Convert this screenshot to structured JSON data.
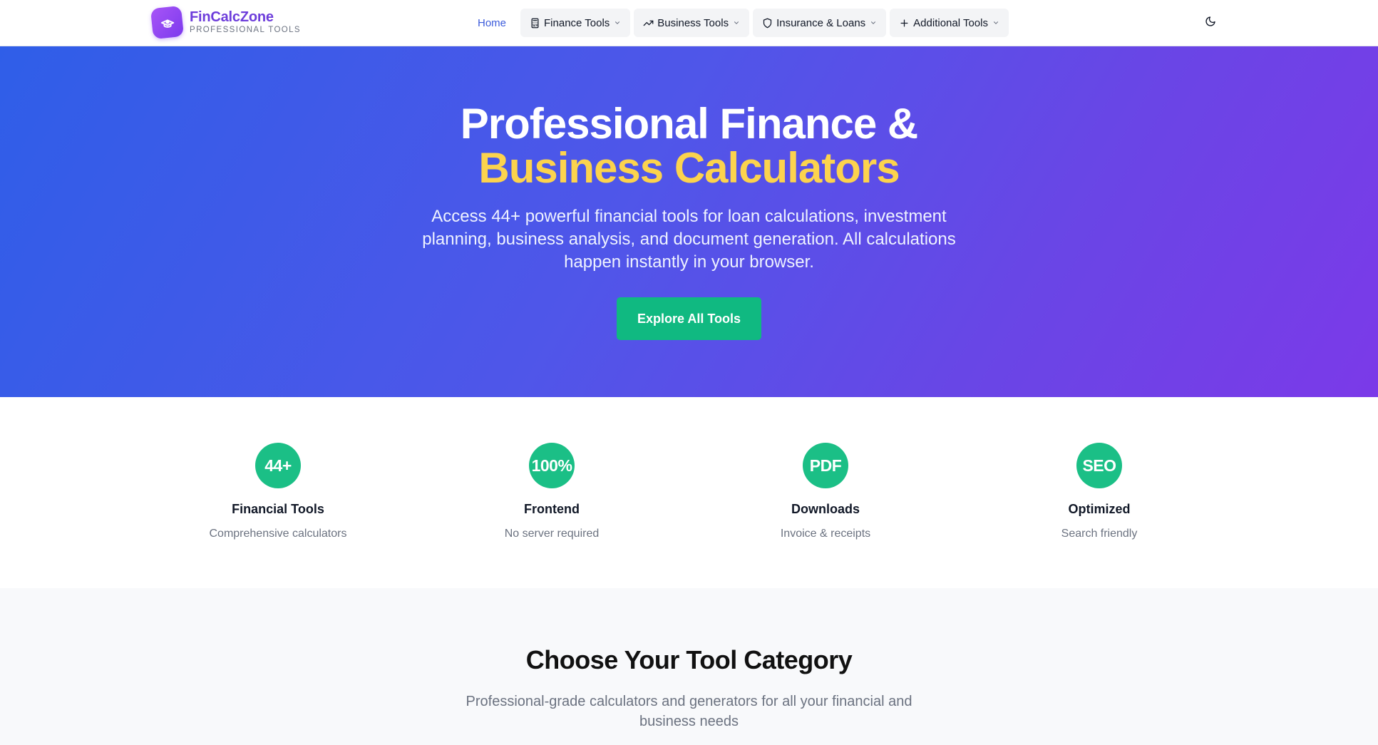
{
  "brand": {
    "name": "FinCalcZone",
    "tagline": "PROFESSIONAL TOOLS",
    "accent_color": "#6d3ddb"
  },
  "nav": {
    "home": "Home",
    "menus": [
      {
        "label": "Finance Tools",
        "icon": "calculator-icon"
      },
      {
        "label": "Business Tools",
        "icon": "trending-up-icon"
      },
      {
        "label": "Insurance & Loans",
        "icon": "shield-icon"
      },
      {
        "label": "Additional Tools",
        "icon": "plus-icon"
      }
    ],
    "theme_toggle_icon": "moon-icon"
  },
  "hero": {
    "title_line1": "Professional Finance &",
    "title_line2": "Business Calculators",
    "description": "Access 44+ powerful financial tools for loan calculations, investment planning, business analysis, and document generation. All calculations happen instantly in your browser.",
    "cta_label": "Explore All Tools",
    "accent_color": "#fcd34d",
    "cta_color": "#10b981"
  },
  "stats": [
    {
      "badge": "44+",
      "title": "Financial Tools",
      "subtitle": "Comprehensive calculators"
    },
    {
      "badge": "100%",
      "title": "Frontend",
      "subtitle": "No server required"
    },
    {
      "badge": "PDF",
      "title": "Downloads",
      "subtitle": "Invoice & receipts"
    },
    {
      "badge": "SEO",
      "title": "Optimized",
      "subtitle": "Search friendly"
    }
  ],
  "category": {
    "title": "Choose Your Tool Category",
    "description": "Professional-grade calculators and generators for all your financial and business needs"
  }
}
